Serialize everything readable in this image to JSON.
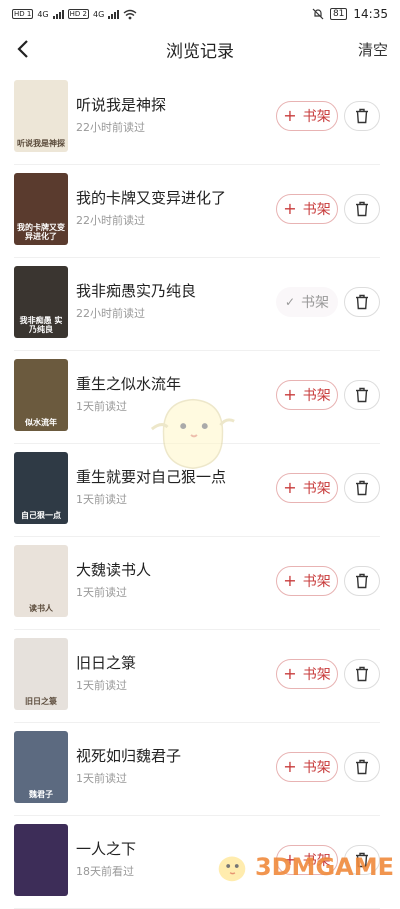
{
  "status_bar": {
    "sim1": "HD 1",
    "sim2": "HD 2",
    "net1": "4G",
    "net2": "4G",
    "battery": "81",
    "time": "14:35"
  },
  "header": {
    "title": "浏览记录",
    "clear_label": "清空"
  },
  "items": [
    {
      "title": "听说我是神探",
      "time": "22小时前读过",
      "shelf_label": "书架",
      "in_shelf": false,
      "cover_text": "听说我是神探",
      "cover_color": "#ede6d7"
    },
    {
      "title": "我的卡牌又变异进化了",
      "time": "22小时前读过",
      "shelf_label": "书架",
      "in_shelf": false,
      "cover_text": "我的卡牌又变异进化了",
      "cover_color": "#5a3b2e"
    },
    {
      "title": "我非痴愚实乃纯良",
      "time": "22小时前读过",
      "shelf_label": "书架",
      "in_shelf": true,
      "cover_text": "我非痴愚 实乃纯良",
      "cover_color": "#3a3530"
    },
    {
      "title": "重生之似水流年",
      "time": "1天前读过",
      "shelf_label": "书架",
      "in_shelf": false,
      "cover_text": "似水流年",
      "cover_color": "#6b5a3e"
    },
    {
      "title": "重生就要对自己狠一点",
      "time": "1天前读过",
      "shelf_label": "书架",
      "in_shelf": false,
      "cover_text": "自己狠一点",
      "cover_color": "#2f3a45"
    },
    {
      "title": "大魏读书人",
      "time": "1天前读过",
      "shelf_label": "书架",
      "in_shelf": false,
      "cover_text": "读书人",
      "cover_color": "#e9e2da"
    },
    {
      "title": "旧日之箓",
      "time": "1天前读过",
      "shelf_label": "书架",
      "in_shelf": false,
      "cover_text": "旧日之箓",
      "cover_color": "#e6e1dc"
    },
    {
      "title": "视死如归魏君子",
      "time": "1天前读过",
      "shelf_label": "书架",
      "in_shelf": false,
      "cover_text": "魏君子",
      "cover_color": "#5c6a80"
    },
    {
      "title": "一人之下",
      "time": "18天前看过",
      "shelf_label": "书架",
      "in_shelf": false,
      "cover_text": "",
      "cover_color": "#3d2d58"
    }
  ],
  "watermark": {
    "text": "3DMGAME"
  }
}
